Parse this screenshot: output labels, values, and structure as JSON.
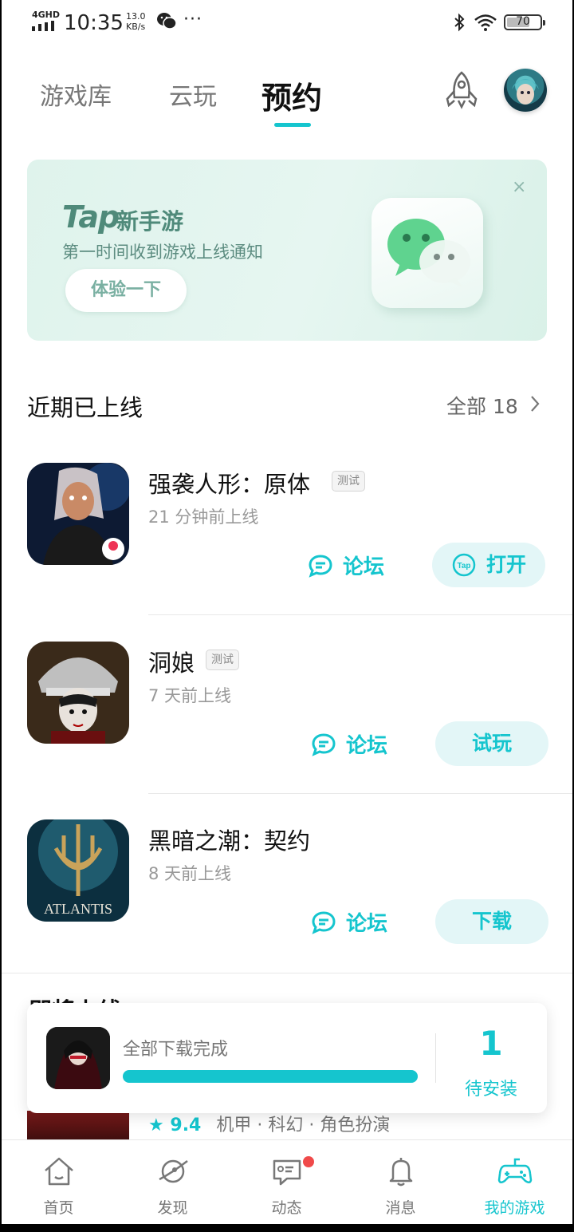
{
  "status_bar": {
    "network": "4GHD",
    "time": "10:35",
    "speed_value": "13.0",
    "speed_unit": "KB/s",
    "more": "···",
    "battery": "70"
  },
  "top_tabs": [
    {
      "label": "游戏库",
      "active": false
    },
    {
      "label": "云玩",
      "active": false
    },
    {
      "label": "预约",
      "active": true
    }
  ],
  "banner": {
    "brand": "Tap",
    "brand_suffix": "新手游",
    "subtitle": "第一时间收到游戏上线通知",
    "button": "体验一下",
    "close": "×"
  },
  "recent_section": {
    "title": "近期已上线",
    "more_label": "全部 18"
  },
  "games": [
    {
      "title": "强袭人形：原体",
      "tag": "测试",
      "time": "21 分钟前上线",
      "forum": "论坛",
      "action": "打开"
    },
    {
      "title": "洞娘",
      "tag": "测试",
      "time": "7 天前上线",
      "forum": "论坛",
      "action": "试玩"
    },
    {
      "title": "黑暗之潮：契约",
      "tag": "",
      "time": "8 天前上线",
      "forum": "论坛",
      "action": "下载",
      "icon_text": "ATLANTIS"
    }
  ],
  "upcoming_section": {
    "title": "即将上线"
  },
  "row4": {
    "score": "9.4",
    "tags": "机甲 · 科幻 · 角色扮演"
  },
  "download_card": {
    "status": "全部下载完成",
    "progress": 1.0,
    "count": "1",
    "pending_label": "待安装"
  },
  "bottom_nav": [
    {
      "label": "首页",
      "icon": "home-icon",
      "active": false
    },
    {
      "label": "发现",
      "icon": "discover-planet-icon",
      "active": false
    },
    {
      "label": "动态",
      "icon": "feed-message-icon",
      "active": false,
      "badge": true
    },
    {
      "label": "消息",
      "icon": "bell-icon",
      "active": false
    },
    {
      "label": "我的游戏",
      "icon": "gamepad-icon",
      "active": true
    }
  ],
  "colors": {
    "accent": "#15c5ce",
    "banner_bg": "#dff3ec",
    "badge": "#f04a4a"
  }
}
